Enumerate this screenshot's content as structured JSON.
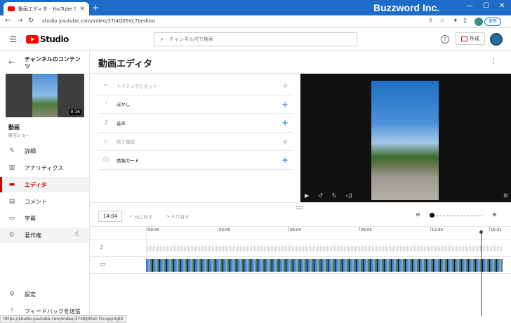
{
  "browser": {
    "tab_title": "動画エディタ - YouTube Studio",
    "url": "studio.youtube.com/video/37i4Q05Vc7I/editor",
    "brand": "Buzzword Inc.",
    "update_label": "更新",
    "status_url": "https://studio.youtube.com/video/37i4Q05Vc7I/copyright"
  },
  "header": {
    "logo_text": "Studio",
    "search_placeholder": "チャンネル内で検索",
    "create_label": "作成",
    "help_glyph": "?"
  },
  "sidebar": {
    "title": "チャンネルのコンテンツ",
    "video_duration": "0:16",
    "video_title": "動画",
    "video_subtitle": "航空ショー",
    "items": [
      {
        "label": "詳細",
        "icon": "pencil-icon"
      },
      {
        "label": "アナリティクス",
        "icon": "analytics-icon"
      },
      {
        "label": "エディタ",
        "icon": "editor-icon",
        "active": true
      },
      {
        "label": "コメント",
        "icon": "comment-icon"
      },
      {
        "label": "字幕",
        "icon": "subtitles-icon"
      },
      {
        "label": "著作権",
        "icon": "copyright-icon"
      }
    ],
    "bottom": [
      {
        "label": "設定",
        "icon": "gear-icon"
      },
      {
        "label": "フィードバックを送信",
        "icon": "feedback-icon"
      }
    ]
  },
  "main": {
    "title": "動画エディタ",
    "tools": [
      {
        "label": "トリミングとカット",
        "icon": "scissors-icon",
        "disabled": true
      },
      {
        "label": "ぼかし",
        "icon": "blur-icon",
        "disabled": false
      },
      {
        "label": "音声",
        "icon": "music-icon",
        "disabled": false
      },
      {
        "label": "終了画面",
        "icon": "endscreen-icon",
        "disabled": true
      },
      {
        "label": "情報カード",
        "icon": "info-icon",
        "disabled": false
      }
    ],
    "timeline": {
      "current_time": "14:04",
      "undo_label": "元に戻す",
      "redo_label": "やり直す",
      "ticks": [
        "00:00",
        "03:00",
        "06:00",
        "09:00",
        "12:00",
        "15:01"
      ]
    }
  },
  "colors": {
    "accent_red": "#cc0000",
    "link_blue": "#1a73e8",
    "chrome_blue": "#1e6cc8"
  }
}
